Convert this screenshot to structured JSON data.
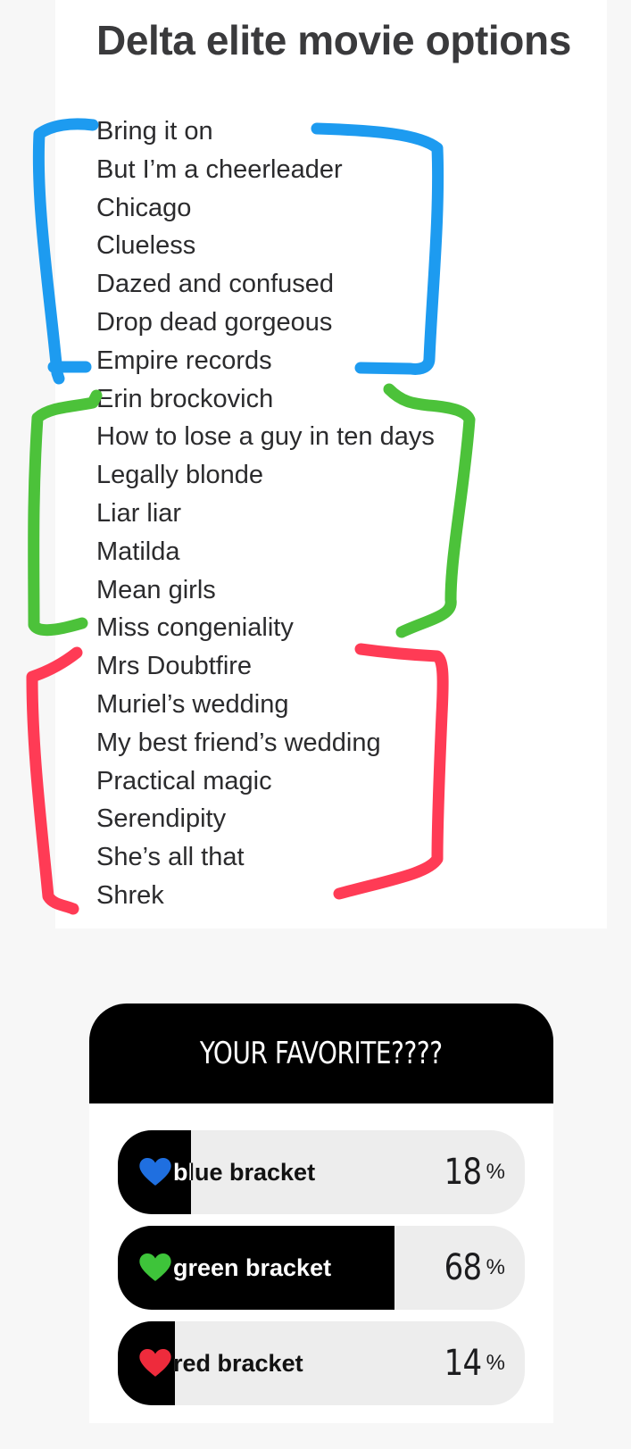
{
  "title": "Delta elite movie options",
  "movies": [
    "Bring it on",
    "But I’m a cheerleader",
    "Chicago",
    "Clueless",
    "Dazed and confused",
    "Drop dead gorgeous",
    "Empire records",
    "Erin brockovich",
    "How to lose a guy in ten days",
    "Legally blonde",
    "Liar liar",
    "Matilda",
    "Mean girls",
    "Miss congeniality",
    "Mrs Doubtfire",
    "Muriel’s wedding",
    "My best friend’s wedding",
    "Practical magic",
    "Serendipity",
    "She’s all that",
    "Shrek"
  ],
  "brackets": {
    "blue": "#1d9bf0",
    "green": "#4cc23a",
    "red": "#ff3b55"
  },
  "poll": {
    "question": "YOUR FAVORITE????",
    "options": [
      {
        "label": "blue bracket",
        "percent": "18",
        "icon": "blue-heart-icon",
        "color": "#1f6fe0",
        "fraction": 0.18
      },
      {
        "label": "green bracket",
        "percent": "68",
        "icon": "green-heart-icon",
        "color": "#3ec43a",
        "fraction": 0.68
      },
      {
        "label": "red bracket",
        "percent": "14",
        "icon": "red-heart-icon",
        "color": "#ee2b3c",
        "fraction": 0.14
      }
    ],
    "percent_sign": "%"
  }
}
